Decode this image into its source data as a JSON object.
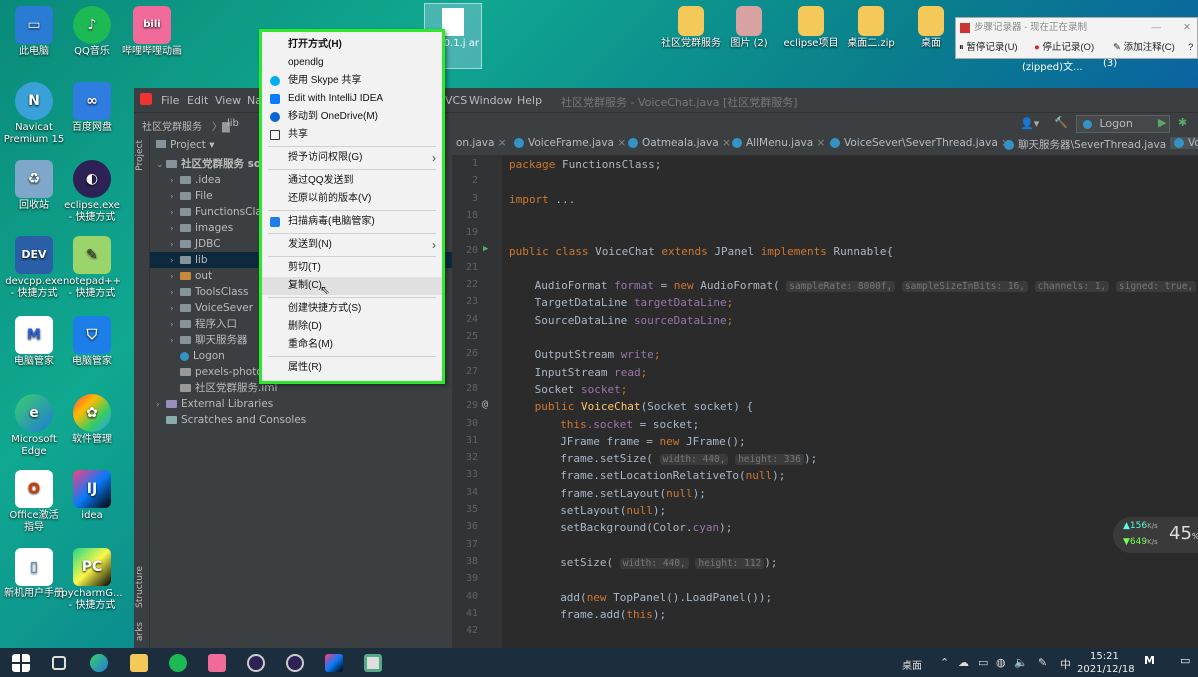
{
  "desktop_icons": [
    {
      "label": "此电脑",
      "icon": "computer-icon"
    },
    {
      "label": "QQ音乐",
      "icon": "qq-music-icon"
    },
    {
      "label": "哔哩哔哩动画",
      "icon": "bilibili-icon"
    },
    {
      "label": "Navicat Premium 15",
      "icon": "navicat-icon"
    },
    {
      "label": "百度网盘",
      "icon": "baidu-netdisk-icon"
    },
    {
      "label": "回收站",
      "icon": "recycle-bin-icon"
    },
    {
      "label": "eclipse.exe - 快捷方式",
      "icon": "eclipse-icon"
    },
    {
      "label": "devcpp.exe - 快捷方式",
      "icon": "devcpp-icon"
    },
    {
      "label": "notepad++ - 快捷方式",
      "icon": "notepadpp-icon"
    },
    {
      "label": "电脑管家",
      "icon": "pc-manager-icon"
    },
    {
      "label": "电脑管家",
      "icon": "shield-icon"
    },
    {
      "label": "Microsoft Edge",
      "icon": "edge-icon"
    },
    {
      "label": "软件管理",
      "icon": "software-manager-icon"
    },
    {
      "label": "Office激活 指导",
      "icon": "office-icon"
    },
    {
      "label": "idea",
      "icon": "intellij-icon"
    },
    {
      "label": "新机用户手册",
      "icon": "manual-icon"
    },
    {
      "label": "pycharmG... - 快捷方式",
      "icon": "pycharm-icon"
    }
  ],
  "top_desktop": {
    "file_label": "r-1.0.1.j ar",
    "items": [
      "社区党群服务",
      "图片 (2)",
      "eclipse项目",
      "桌面二.zip",
      "桌面"
    ],
    "zip_label": "(zipped)文...",
    "num_label": "(3)"
  },
  "psr": {
    "title": "步骤记录器 - 现在正在录制",
    "pause": "暂停记录(U)",
    "stop": "停止记录(O)",
    "add_comment": "添加注释(C)"
  },
  "ide": {
    "menu": [
      "File",
      "Edit",
      "View",
      "Na",
      "VCS",
      "Window",
      "Help"
    ],
    "window_title": "社区党群服务 - VoiceChat.java [社区党群服务]",
    "breadcrumb": [
      "社区党群服务",
      "lib"
    ],
    "run_config": "Logon",
    "project_label": "Project",
    "side_project": "Project",
    "side_structure": "Structure",
    "side_bookmarks": "arks",
    "tree": [
      {
        "label": "社区党群服务 so",
        "indent": 0,
        "type": "root"
      },
      {
        "label": ".idea",
        "indent": 1,
        "type": "folder"
      },
      {
        "label": "File",
        "indent": 1,
        "type": "folder"
      },
      {
        "label": "FunctionsClas",
        "indent": 1,
        "type": "folder"
      },
      {
        "label": "images",
        "indent": 1,
        "type": "folder"
      },
      {
        "label": "JDBC",
        "indent": 1,
        "type": "folder"
      },
      {
        "label": "lib",
        "indent": 1,
        "type": "folder",
        "selected": true
      },
      {
        "label": "out",
        "indent": 1,
        "type": "folder-orange"
      },
      {
        "label": "ToolsClass",
        "indent": 1,
        "type": "folder"
      },
      {
        "label": "VoiceSever",
        "indent": 1,
        "type": "folder"
      },
      {
        "label": "程序入口",
        "indent": 1,
        "type": "folder"
      },
      {
        "label": "聊天服务器",
        "indent": 1,
        "type": "folder"
      },
      {
        "label": "Logon",
        "indent": 1,
        "type": "class"
      },
      {
        "label": "pexels-photo",
        "indent": 1,
        "type": "file"
      },
      {
        "label": "社区党群服务.iml",
        "indent": 1,
        "type": "file"
      },
      {
        "label": "External Libraries",
        "indent": 0,
        "type": "lib"
      },
      {
        "label": "Scratches and Consoles",
        "indent": 0,
        "type": "scratch"
      }
    ],
    "tabs": [
      "on.java",
      "VoiceFrame.java",
      "Oatmeala.java",
      "AllMenu.java",
      "VoiceSever\\SeverThread.java",
      "聊天服务器\\SeverThread.java",
      "Vo"
    ],
    "line_numbers": [
      "1",
      "2",
      "3",
      "18",
      "19",
      "20",
      "21",
      "22",
      "23",
      "24",
      "25",
      "26",
      "27",
      "28",
      "29",
      "30",
      "31",
      "32",
      "33",
      "34",
      "35",
      "36",
      "37",
      "38",
      "39",
      "40",
      "41",
      "42"
    ],
    "code": {
      "l1_kw": "package",
      "l1": " FunctionsClass;",
      "l3_kw": "import",
      "l3": " ...",
      "l20_a": "public class",
      "l20_b": " VoiceChat ",
      "l20_c": "extends",
      "l20_d": " JPanel ",
      "l20_e": "implements",
      "l20_f": " Runnable{",
      "l22_a": "AudioFormat ",
      "l22_b": "format",
      "l22_c": " = ",
      "l22_d": "new",
      "l22_e": " AudioFormat( ",
      "h1": "sampleRate: 8000f,",
      "h2": "sampleSizeInBits: 16,",
      "h3": "channels: 1,",
      "h4": "signed: true,",
      "h5": "bigEndia",
      "l23_a": "TargetDataLine ",
      "l23_b": "targetDataLine",
      "l23_c": ";",
      "l24_a": "SourceDataLine ",
      "l24_b": "sourceDataLine",
      "l24_c": ";",
      "l26_a": "OutputStream ",
      "l26_b": "write",
      "l26_c": ";",
      "l27_a": "InputStream ",
      "l27_b": "read",
      "l27_c": ";",
      "l28_a": "Socket ",
      "l28_b": "socket",
      "l28_c": ";",
      "l29_a": "public ",
      "l29_b": "VoiceChat",
      "l29_c": "(Socket socket) {",
      "l30_a": "this",
      "l30_b": ".socket",
      "l30_c": " = socket;",
      "l31_a": "JFrame frame = ",
      "l31_b": "new",
      "l31_c": " JFrame();",
      "l32_a": "frame.setSize( ",
      "l32_h1": "width: 440,",
      "l32_h2": "height: 336",
      "l32_c": ");",
      "l33_a": "frame.setLocationRelativeTo(",
      "l33_b": "null",
      "l33_c": ");",
      "l34_a": "frame.setLayout(",
      "l34_b": "null",
      "l34_c": ");",
      "l35_a": "setLayout(",
      "l35_b": "null",
      "l35_c": ");",
      "l36_a": "setBackground(Color.",
      "l36_b": "cyan",
      "l36_c": ");",
      "l38_a": "setSize( ",
      "l38_h1": "width: 440,",
      "l38_h2": "height: 112",
      "l38_c": ");",
      "l40_a": "add(",
      "l40_b": "new",
      "l40_c": " TopPanel().LoadPanel());",
      "l41_a": "frame.add(",
      "l41_b": "this",
      "l41_c": ");"
    }
  },
  "context_menu": [
    {
      "label": "打开方式(H)",
      "bold": true
    },
    {
      "label": "opendlg"
    },
    {
      "label": "使用 Skype 共享",
      "icon": "skype-icon"
    },
    {
      "label": "Edit with IntelliJ IDEA",
      "icon": "intellij-icon"
    },
    {
      "label": "移动到 OneDrive(M)",
      "icon": "onedrive-icon"
    },
    {
      "label": "共享",
      "icon": "share-icon"
    },
    {
      "label": "授予访问权限(G)",
      "submenu": true
    },
    {
      "label": "通过QQ发送到"
    },
    {
      "label": "还原以前的版本(V)"
    },
    {
      "label": "扫描病毒(电脑管家)",
      "icon": "shield-icon"
    },
    {
      "label": "发送到(N)",
      "submenu": true
    },
    {
      "label": "剪切(T)"
    },
    {
      "label": "复制(C)",
      "highlighted": true
    },
    {
      "label": "创建快捷方式(S)"
    },
    {
      "label": "删除(D)"
    },
    {
      "label": "重命名(M)"
    },
    {
      "label": "属性(R)"
    }
  ],
  "net_widget": {
    "up": "156",
    "up_unit": "K/s",
    "down": "649",
    "down_unit": "K/s",
    "percent": "45",
    "percent_unit": "%"
  },
  "taskbar": {
    "desktop_label": "桌面",
    "time": "15:21",
    "date": "2021/12/18",
    "ime": "中"
  }
}
